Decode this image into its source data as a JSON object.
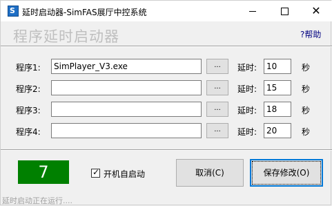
{
  "window": {
    "title": "延时启动器-SimFAS展厅中控系统",
    "icon_text": "S"
  },
  "header": {
    "title": "程序延时启动器",
    "help": "?帮助"
  },
  "programs": [
    {
      "label": "程序1:",
      "path": "SimPlayer_V3.exe",
      "browse": "...",
      "delay_label": "延时:",
      "delay": "10",
      "unit": "秒"
    },
    {
      "label": "程序2:",
      "path": "",
      "browse": "...",
      "delay_label": "延时:",
      "delay": "15",
      "unit": "秒"
    },
    {
      "label": "程序3:",
      "path": "",
      "browse": "...",
      "delay_label": "延时:",
      "delay": "18",
      "unit": "秒"
    },
    {
      "label": "程序4:",
      "path": "",
      "browse": "...",
      "delay_label": "延时:",
      "delay": "20",
      "unit": "秒"
    }
  ],
  "footer": {
    "countdown": "7",
    "autostart_label": "开机自启动",
    "autostart_checked": true,
    "cancel": "取消(C)",
    "save": "保存修改(O)"
  },
  "status": "延时启动正在运行....",
  "colors": {
    "countdown_bg": "#008000",
    "title_gray": "#bfbfbf",
    "help_blue": "#000080",
    "focus_blue": "#0078d7"
  }
}
